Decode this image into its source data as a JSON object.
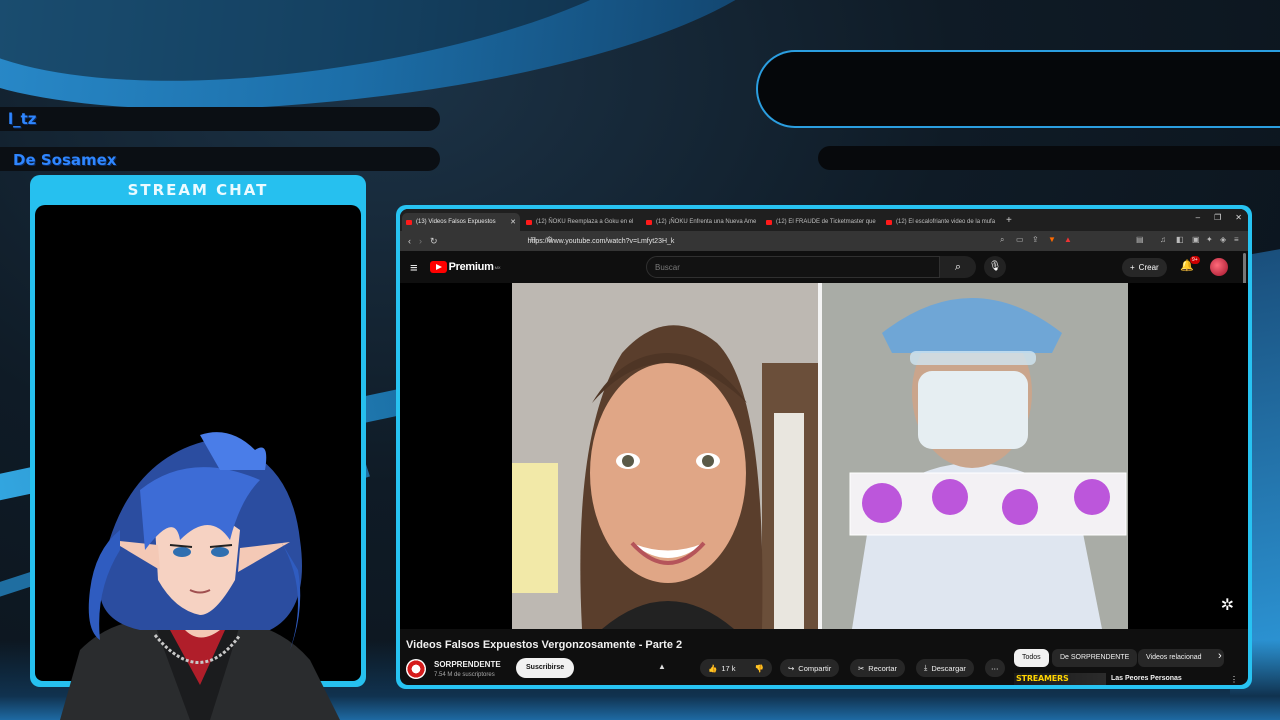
{
  "overlay": {
    "username": "l_tz",
    "streamer": "De Sosamex",
    "chat_title": "STREAM CHAT"
  },
  "browser": {
    "tabs": [
      {
        "label": "(13) Videos Falsos Expuestos",
        "active": true
      },
      {
        "label": "(12) ÑOKU Reemplaza a Goku en el"
      },
      {
        "label": "(12) ¡ÑOKU Enfrenta una Nueva Ame"
      },
      {
        "label": "(12) El FRAUDE de Ticketmaster que"
      },
      {
        "label": "(12) El escalofriante video de la mufa"
      }
    ],
    "url": "https://www.youtube.com/watch?v=Lmfyt23H_k"
  },
  "youtube": {
    "logo_text": "Premium",
    "logo_region": "MX",
    "search_placeholder": "Buscar",
    "create_label": "Crear",
    "notif_count": "9+",
    "video_title": "Videos Falsos Expuestos Vergonzosamente - Parte 2",
    "channel_name": "SORPRENDENTE",
    "channel_subs": "7.54 M de suscriptores",
    "subscribe_label": "Suscribirse",
    "likes": "17 k",
    "share_label": "Compartir",
    "clip_label": "Recortar",
    "download_label": "Descargar",
    "chips": [
      "Todos",
      "De SORPRENDENTE",
      "Videos relacionad"
    ],
    "related_thumb_text": "STREAMERS EXPUESTOS",
    "related_title": "Las Peores Personas"
  },
  "colors": {
    "overlay_accent": "#27c3f2",
    "name_text": "#2f86ff",
    "yt_red": "#ff0000"
  },
  "icons": {
    "back": "arrow-left-icon",
    "forward": "arrow-right-icon",
    "reload": "reload-icon",
    "search": "search-icon",
    "mic": "mic-icon",
    "bell": "bell-icon",
    "like": "thumbs-up-icon",
    "dislike": "thumbs-down-icon",
    "share": "share-icon",
    "clip": "scissors-icon",
    "download": "download-icon",
    "more": "more-icon"
  }
}
